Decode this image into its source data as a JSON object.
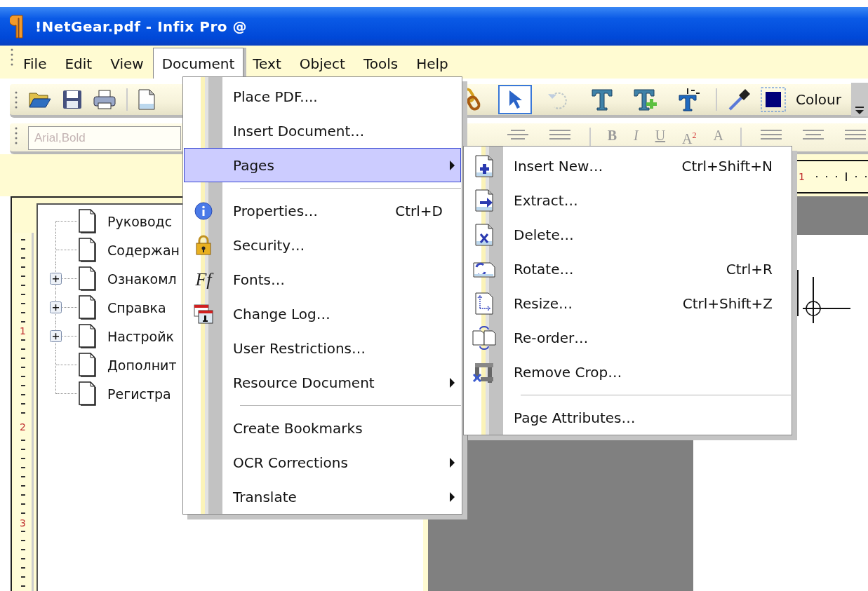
{
  "window": {
    "title": "!NetGear.pdf - Infix Pro @"
  },
  "menubar": [
    {
      "label": "File",
      "selected": false
    },
    {
      "label": "Edit",
      "selected": false
    },
    {
      "label": "View",
      "selected": false
    },
    {
      "label": "Document",
      "selected": true
    },
    {
      "label": "Text",
      "selected": false
    },
    {
      "label": "Object",
      "selected": false
    },
    {
      "label": "Tools",
      "selected": false
    },
    {
      "label": "Help",
      "selected": false
    }
  ],
  "toolbar": {
    "file_buttons": [
      {
        "kind": "open"
      },
      {
        "kind": "save"
      },
      {
        "kind": "print"
      },
      {
        "kind": "new-page"
      }
    ],
    "tools": [
      {
        "kind": "link",
        "selected": false,
        "disabled": false
      },
      {
        "kind": "pointer",
        "selected": true,
        "disabled": false
      },
      {
        "kind": "rotate",
        "selected": false,
        "disabled": true
      },
      {
        "kind": "text",
        "selected": false,
        "disabled": false
      },
      {
        "kind": "add-text",
        "selected": false,
        "disabled": false
      },
      {
        "kind": "numbering",
        "selected": false,
        "disabled": false
      }
    ],
    "colour_label": "Colour"
  },
  "format_bar": {
    "disabled": true,
    "font_field": {
      "value": "Arial,Bold"
    },
    "buttons": [
      {
        "label": "B",
        "kind": "bold"
      },
      {
        "label": "I",
        "kind": "italic"
      },
      {
        "label": "U",
        "kind": "underline"
      },
      {
        "label": "A$^{2}$",
        "kind": "plain"
      },
      {
        "label": "A",
        "kind": "plain"
      }
    ]
  },
  "ruler_top": {
    "labels": [
      "1"
    ]
  },
  "ruler_left": {
    "labels": [
      "1",
      "2",
      "3"
    ]
  },
  "tree": [
    {
      "label": "Руководс",
      "kind": "leaf"
    },
    {
      "label": "Содержан",
      "kind": "leaf"
    },
    {
      "label": "Ознакомл",
      "kind": "branch"
    },
    {
      "label": "Справка",
      "kind": "branch"
    },
    {
      "label": "Настройк",
      "kind": "branch"
    },
    {
      "label": "Дополнит",
      "kind": "leaf"
    },
    {
      "label": "Регистра",
      "kind": "leaf"
    }
  ],
  "document_menu": {
    "items": [
      {
        "kind": "item",
        "label": "Place PDF....",
        "selected": false,
        "submenu": false
      },
      {
        "kind": "item",
        "label": "Insert Document…",
        "selected": false,
        "submenu": false
      },
      {
        "kind": "item",
        "label": "Pages",
        "selected": true,
        "submenu": true
      },
      {
        "kind": "separator"
      },
      {
        "kind": "item",
        "label": "Properties…",
        "shortcut": "Ctrl+D",
        "selected": false,
        "submenu": false
      },
      {
        "kind": "item",
        "label": "Security…",
        "selected": false,
        "submenu": false
      },
      {
        "kind": "item",
        "label": "Fonts…",
        "icon_label": "Ff",
        "selected": false,
        "submenu": false
      },
      {
        "kind": "item",
        "label": "Change Log…",
        "selected": false,
        "submenu": false
      },
      {
        "kind": "item",
        "label": "User Restrictions…",
        "selected": false,
        "submenu": false
      },
      {
        "kind": "item",
        "label": "Resource Document",
        "selected": false,
        "submenu": true
      },
      {
        "kind": "separator"
      },
      {
        "kind": "item",
        "label": "Create Bookmarks",
        "selected": false,
        "submenu": false
      },
      {
        "kind": "item",
        "label": "OCR Corrections",
        "selected": false,
        "submenu": true
      },
      {
        "kind": "item",
        "label": "Translate",
        "selected": false,
        "submenu": true
      }
    ]
  },
  "pages_submenu": {
    "items": [
      {
        "kind": "item",
        "label": "Insert New…",
        "shortcut": "Ctrl+Shift+N",
        "selected": false,
        "submenu": false
      },
      {
        "kind": "item",
        "label": "Extract…",
        "selected": false,
        "submenu": false
      },
      {
        "kind": "item",
        "label": "Delete…",
        "selected": false,
        "submenu": false
      },
      {
        "kind": "item",
        "label": "Rotate…",
        "shortcut": "Ctrl+R",
        "selected": false,
        "submenu": false
      },
      {
        "kind": "item",
        "label": "Resize…",
        "shortcut": "Ctrl+Shift+Z",
        "selected": false,
        "submenu": false
      },
      {
        "kind": "item",
        "label": "Re-order…",
        "selected": false,
        "submenu": false
      },
      {
        "kind": "item",
        "label": "Remove Crop…",
        "selected": false,
        "submenu": false
      },
      {
        "kind": "separator"
      },
      {
        "kind": "item",
        "label": "Page Attributes…",
        "selected": false,
        "submenu": false
      }
    ]
  }
}
